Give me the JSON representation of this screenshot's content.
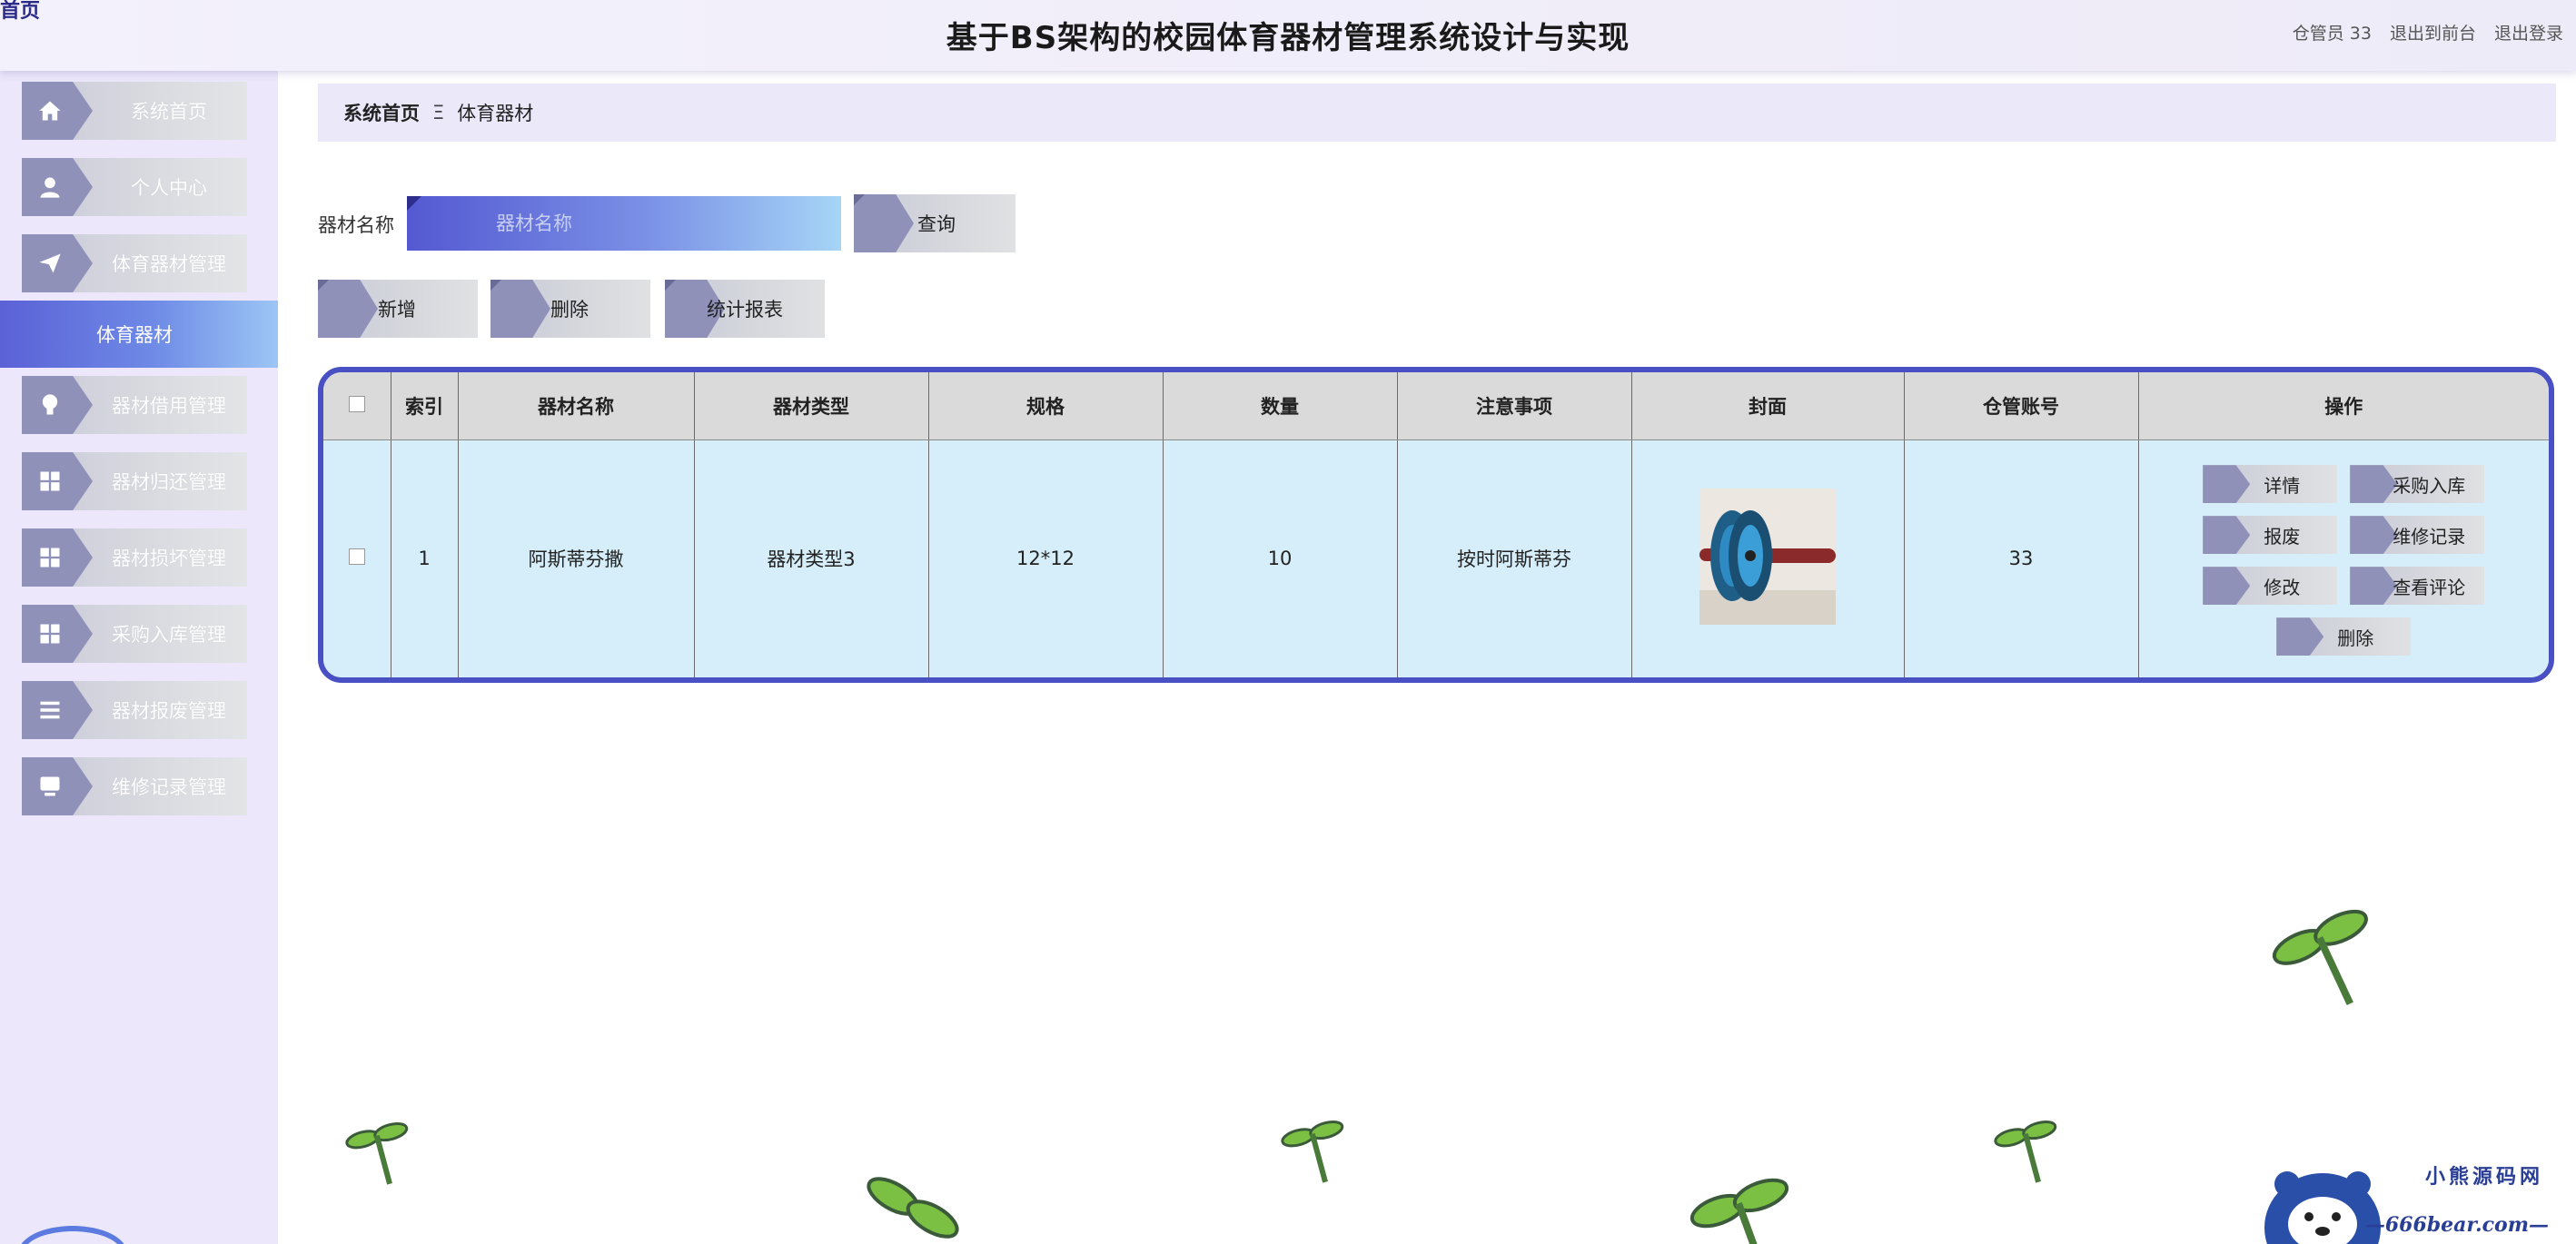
{
  "header": {
    "corner_text": "首页",
    "title": "基于BS架构的校园体育器材管理系统设计与实现",
    "user_label": "仓管员 33",
    "exit_front_label": "退出到前台",
    "logout_label": "退出登录"
  },
  "sidebar": {
    "items": [
      {
        "label": "系统首页",
        "icon": "home-icon"
      },
      {
        "label": "个人中心",
        "icon": "user-icon"
      },
      {
        "label": "体育器材管理",
        "icon": "paper-plane-icon"
      },
      {
        "label": "器材借用管理",
        "icon": "lightbulb-icon"
      },
      {
        "label": "器材归还管理",
        "icon": "grid-icon"
      },
      {
        "label": "器材损坏管理",
        "icon": "grid-icon"
      },
      {
        "label": "采购入库管理",
        "icon": "grid-icon"
      },
      {
        "label": "器材报废管理",
        "icon": "list-icon"
      },
      {
        "label": "维修记录管理",
        "icon": "monitor-icon"
      }
    ],
    "active_sub_item": "体育器材"
  },
  "breadcrumb": {
    "home": "系统首页",
    "separator": "Ξ",
    "current": "体育器材"
  },
  "search": {
    "label": "器材名称",
    "placeholder": "器材名称",
    "value": "",
    "query_label": "查询"
  },
  "toolbar": {
    "add_label": "新增",
    "delete_label": "删除",
    "report_label": "统计报表"
  },
  "table": {
    "columns": [
      "",
      "索引",
      "器材名称",
      "器材类型",
      "规格",
      "数量",
      "注意事项",
      "封面",
      "仓管账号",
      "操作"
    ],
    "rows": [
      {
        "index": "1",
        "name": "阿斯蒂芬撒",
        "type": "器材类型3",
        "spec": "12*12",
        "quantity": "10",
        "notes": "按时阿斯蒂芬",
        "account": "33",
        "actions": [
          "详情",
          "采购入库",
          "报废",
          "维修记录",
          "修改",
          "查看评论",
          "删除"
        ]
      }
    ]
  },
  "watermark": {
    "title": "小熊源码网",
    "subtitle": "—666bear.com—"
  },
  "colors": {
    "accent": "#4950c4",
    "sidebar_bg": "#ece7fa",
    "icon_bg": "#8f91b9",
    "table_row_bg": "#d5eefa",
    "decor_green": "#7bc043"
  }
}
